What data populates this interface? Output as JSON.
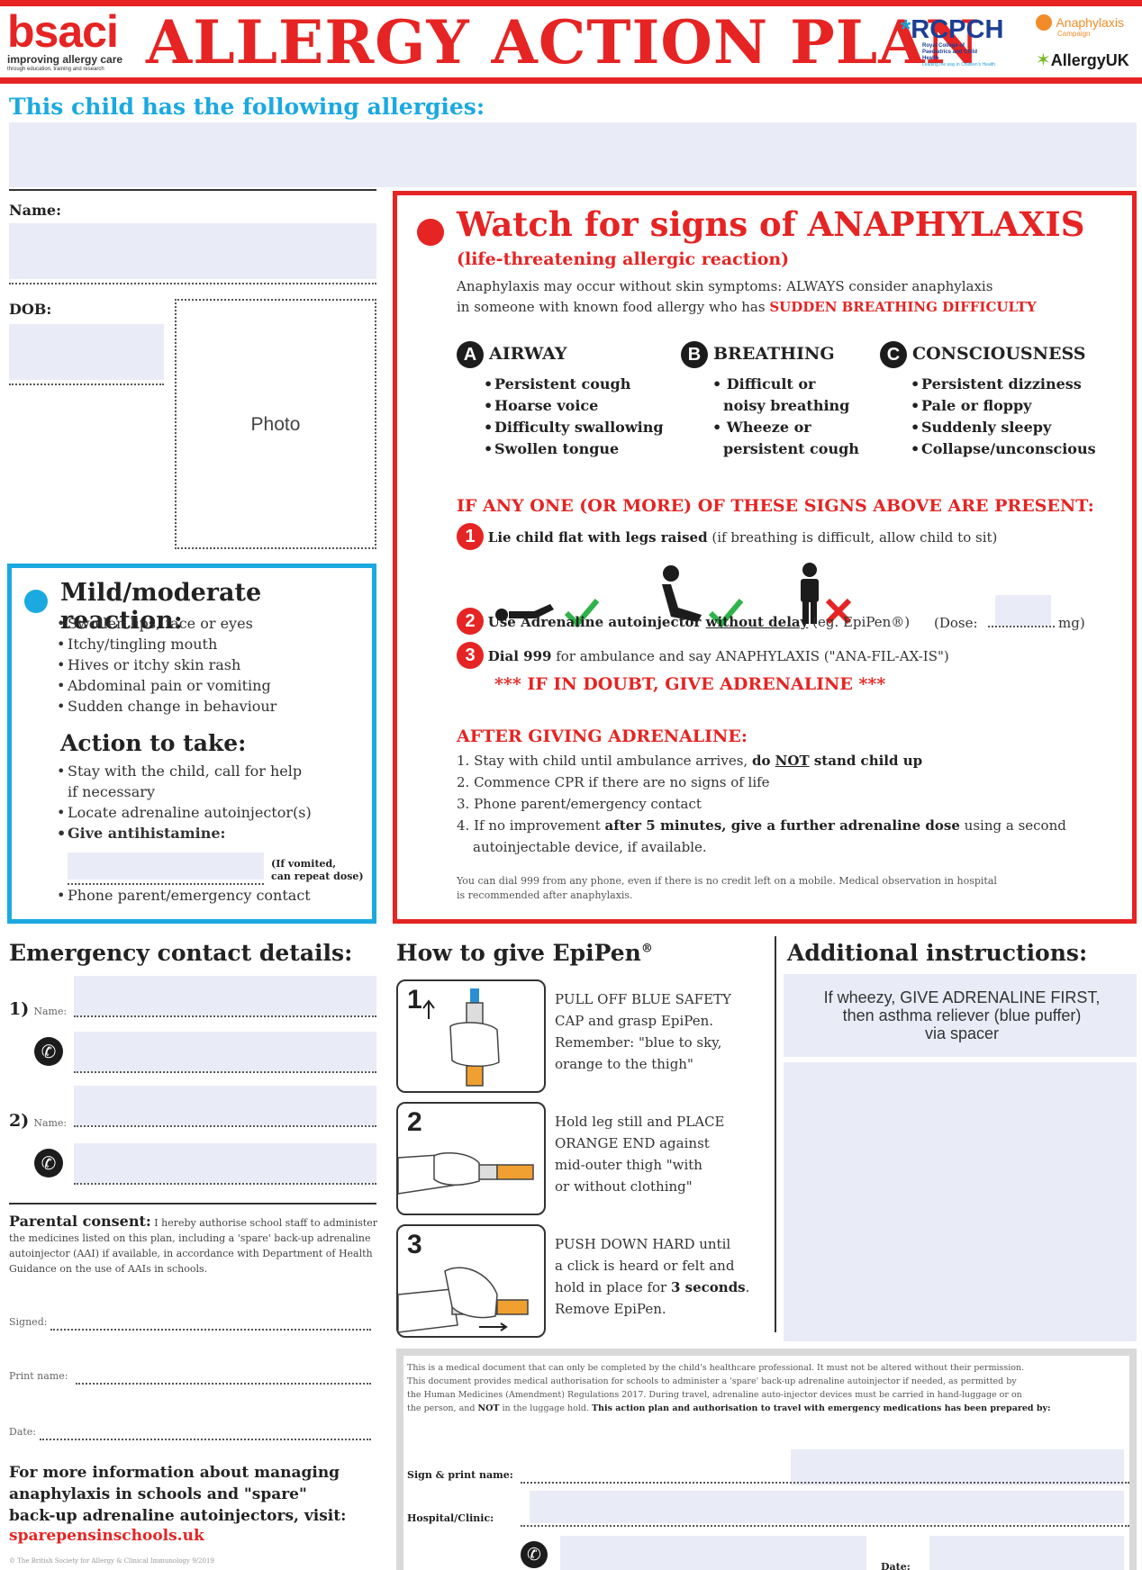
{
  "header": {
    "logo_main": "bsaci",
    "logo_tagline": "improving allergy care",
    "logo_subtagline": "through education, training and research",
    "title": "ALLERGY ACTION PLAN",
    "rcpch": "RCPCH",
    "rcpch_sub": "Royal College of Paediatrics and Child Health",
    "rcpch_tag": "Leading the way in Children's Health",
    "anaphylaxis_campaign": "Anaphylaxis",
    "anaphylaxis_campaign_sub": "Campaign",
    "allergyuk": "AllergyUK"
  },
  "allergies": {
    "heading": "This child has the following allergies:"
  },
  "child": {
    "name_label": "Name:",
    "dob_label": "DOB:",
    "photo_label": "Photo"
  },
  "mild": {
    "heading": "Mild/moderate reaction:",
    "symptoms": [
      "Swollen lips, face or eyes",
      "Itchy/tingling mouth",
      "Hives or itchy skin rash",
      "Abdominal pain or vomiting",
      "Sudden change in behaviour"
    ],
    "action_heading": "Action to take:",
    "action_1": "Stay with the child, call for help",
    "action_1b": "if necessary",
    "action_2": "Locate adrenaline autoinjector(s)",
    "action_3": "Give antihistamine:",
    "antihistamine_note_1": "(If vomited,",
    "antihistamine_note_2": "can repeat dose)",
    "action_4": "Phone parent/emergency contact"
  },
  "anaphylaxis": {
    "heading": "Watch for signs of ANAPHYLAXIS",
    "subheading": "(life-threatening allergic reaction)",
    "intro_1": "Anaphylaxis may occur without skin symptoms: ALWAYS consider anaphylaxis",
    "intro_2": "in someone with known food allergy who has ",
    "intro_emph": "SUDDEN BREATHING DIFFICULTY",
    "abc": [
      {
        "letter": "A",
        "title": "AIRWAY",
        "items": [
          "Persistent cough",
          "Hoarse voice",
          "Difficulty swallowing",
          "Swollen tongue"
        ]
      },
      {
        "letter": "B",
        "title": "BREATHING",
        "items": [
          "Difficult or",
          "noisy breathing",
          "Wheeze or",
          "persistent cough"
        ]
      },
      {
        "letter": "C",
        "title": "CONSCIOUSNESS",
        "items": [
          "Persistent dizziness",
          "Pale or floppy",
          "Suddenly sleepy",
          "Collapse/unconscious"
        ]
      }
    ],
    "if_any_heading": "IF ANY ONE (OR MORE) OF THESE SIGNS ABOVE ARE PRESENT:",
    "step1_num": "1",
    "step1_bold": "Lie child flat with legs raised",
    "step1_rest": " (if breathing is difficult, allow child to sit)",
    "step2_num": "2",
    "step2_bold": "Use Adrenaline autoinjector ",
    "step2_underline": "without delay",
    "step2_rest": " (eg. EpiPen®)",
    "dose_label": "(Dose:",
    "dose_unit": "mg)",
    "step3_num": "3",
    "step3_bold": "Dial 999",
    "step3_rest": " for ambulance and say ANAPHYLAXIS (\"ANA-FIL-AX-IS\")",
    "if_in_doubt": "*** IF IN DOUBT, GIVE ADRENALINE ***",
    "after_heading": "AFTER GIVING ADRENALINE:",
    "after_1": "1. Stay with child until ambulance arrives, ",
    "after_1_bold": "do ",
    "after_1_not": "NOT",
    "after_1_bold2": " stand child up",
    "after_2": "2. Commence CPR if there are no signs of life",
    "after_3": "3. Phone parent/emergency contact",
    "after_4": "4. If no improvement ",
    "after_4_bold": "after 5 minutes, give a further adrenaline dose",
    "after_4_rest": " using a second",
    "after_4b": "autoinjectable device, if available.",
    "footnote_1": "You can dial 999 from any phone, even if there is no credit left on a mobile. Medical observation in hospital",
    "footnote_2": "is recommended after anaphylaxis."
  },
  "emergency": {
    "heading": "Emergency contact details:",
    "c1": "1)",
    "c2": "2)",
    "name_label": "Name:"
  },
  "consent": {
    "heading": "Parental consent:",
    "text": " I hereby authorise school staff to administer the medicines listed on this plan, including a 'spare' back-up adrenaline autoinjector (AAI) if available, in accordance with Department of Health Guidance on the use of AAIs in schools.",
    "signed": "Signed:",
    "print_name": "Print name:",
    "date": "Date:"
  },
  "more_info": {
    "line1": "For more information about managing",
    "line2": "anaphylaxis in schools and \"spare\"",
    "line3": "back-up adrenaline autoinjectors, visit:",
    "link": "sparepensinschools.uk"
  },
  "epipen": {
    "heading": "How to give EpiPen",
    "reg": "®",
    "steps": [
      {
        "num": "1",
        "l1": "PULL OFF BLUE SAFETY",
        "l2": "CAP and grasp EpiPen.",
        "l3": "Remember: \"blue to sky,",
        "l4": "orange to the thigh\""
      },
      {
        "num": "2",
        "l1": "Hold leg still and PLACE",
        "l2": "ORANGE END against",
        "l3": "mid-outer thigh \"with",
        "l4": "or without clothing\""
      },
      {
        "num": "3",
        "l1": "PUSH DOWN HARD until",
        "l2": "a click is heard or felt and",
        "l3": "hold in place for ",
        "l3_bold": "3 seconds",
        "l3_end": ".",
        "l4": "Remove EpiPen."
      }
    ]
  },
  "additional": {
    "heading": "Additional instructions:",
    "line1": "If wheezy, GIVE ADRENALINE FIRST,",
    "line2": "then asthma reliever (blue puffer)",
    "line3": "via spacer"
  },
  "authorisation": {
    "text_1": "This is a medical document that can only be completed by the child's healthcare professional. It must not be altered without their permission.",
    "text_2": "This document provides medical authorisation for schools to administer a 'spare' back-up adrenaline autoinjector if needed, as permitted by",
    "text_3": "the Human Medicines (Amendment) Regulations 2017. During travel, adrenaline auto-injector devices must be carried in hand-luggage or on",
    "text_4a": "the person, and ",
    "text_4_not": "NOT",
    "text_4b": " in the luggage hold. ",
    "text_4_bold": "This action plan and authorisation to travel with emergency medications has been prepared by:",
    "sign_label": "Sign & print name:",
    "hospital_label": "Hospital/Clinic:",
    "date_label": "Date:"
  },
  "footer": {
    "copyright": "© The British Society for Allergy & Clinical Immunology 9/2019"
  },
  "colors": {
    "red": "#e52423",
    "blue": "#1ba9e1",
    "field": "#e9ecf7"
  }
}
